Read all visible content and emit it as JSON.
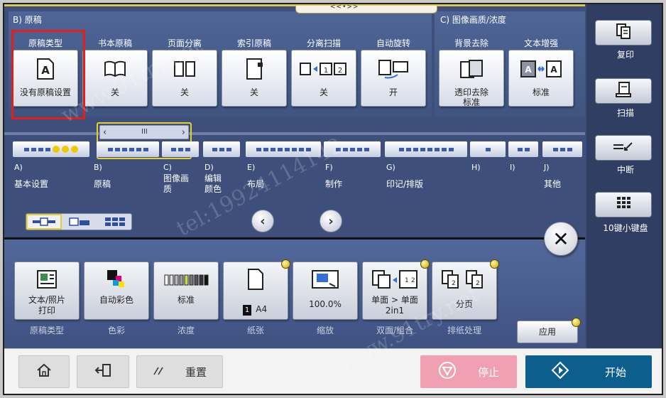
{
  "sections": {
    "b_title": "B)  原稿",
    "c_title": "C)  图像画质/浓度",
    "pull_tab": "<<•>>"
  },
  "functions": [
    {
      "label": "原稿类型",
      "value": "没有原稿设置",
      "icon": "letter-a-document-icon"
    },
    {
      "label": "书本原稿",
      "value": "关",
      "icon": "open-book-icon"
    },
    {
      "label": "页面分离",
      "value": "关",
      "icon": "page-split-icon"
    },
    {
      "label": "索引原稿",
      "value": "关",
      "icon": "index-page-icon"
    },
    {
      "label": "分离扫描",
      "value": "关",
      "icon": "separate-scan-icon"
    },
    {
      "label": "自动旋转",
      "value": "开",
      "icon": "auto-rotate-icon"
    },
    {
      "label": "背景去除",
      "value": "透印去除\n标准",
      "icon": "background-removal-icon"
    },
    {
      "label": "文本增强",
      "value": "标准",
      "icon": "text-enhance-icon"
    }
  ],
  "tabs": [
    {
      "letter": "A)",
      "name": "基本设置"
    },
    {
      "letter": "B)",
      "name": "原稿"
    },
    {
      "letter": "C)",
      "name": "图像画\n质"
    },
    {
      "letter": "D)",
      "name": "编辑\n颜色"
    },
    {
      "letter": "E)",
      "name": "布局"
    },
    {
      "letter": "F)",
      "name": "制作"
    },
    {
      "letter": "G)",
      "name": "印记/排版"
    },
    {
      "letter": "H)",
      "name": ""
    },
    {
      "letter": "I)",
      "name": ""
    },
    {
      "letter": "J)",
      "name": "其他"
    }
  ],
  "scroll": {
    "left": "‹",
    "right": "›",
    "middle": "III"
  },
  "nav": {
    "prev": "‹",
    "next": "›",
    "close": "✕"
  },
  "settings": [
    {
      "value": "文本/照片\n打印",
      "caption": "原稿类型",
      "icon": "photo-document-icon",
      "dot": false
    },
    {
      "value": "自动彩色",
      "caption": "色彩",
      "icon": "color-mode-icon",
      "dot": false
    },
    {
      "value": "标准",
      "caption": "浓度",
      "icon": "density-icon",
      "dot": false
    },
    {
      "value": "A4",
      "tray": "1",
      "caption": "纸张",
      "icon": "paper-icon",
      "dot": true
    },
    {
      "value": "100.0%",
      "caption": "缩放",
      "icon": "zoom-icon",
      "dot": false
    },
    {
      "value": "单面 > 单面\n2in1",
      "caption": "双面/组合",
      "icon": "duplex-combine-icon",
      "dot": true
    },
    {
      "value": "分页",
      "caption": "排纸处理",
      "icon": "collate-icon",
      "dot": true
    }
  ],
  "apply_label": "应用",
  "sidebar": [
    {
      "label": "复印",
      "icon": "copy-icon"
    },
    {
      "label": "扫描",
      "icon": "scan-icon"
    },
    {
      "label": "中断",
      "icon": "interrupt-icon"
    },
    {
      "label": "10键小键盘",
      "icon": "keypad-icon"
    }
  ],
  "bottom": {
    "reset_label": "重置",
    "stop_label": "停止",
    "start_label": "开始"
  },
  "watermark": [
    "www.91try.net",
    "tel:19924114142"
  ],
  "colors": {
    "panel": "#3d4f7a",
    "selection_red": "#e0201d",
    "highlight_yellow": "#e5d02c",
    "stop_pink": "#f1a0b1",
    "start_blue": "#0c5e8c"
  }
}
